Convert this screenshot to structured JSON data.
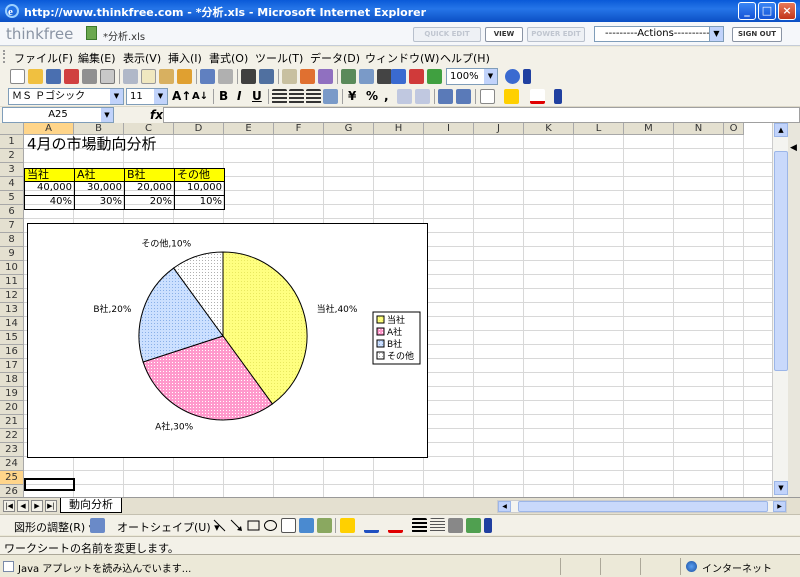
{
  "window": {
    "title": "http://www.thinkfree.com - *分析.xls - Microsoft Internet Explorer",
    "min_glyph": "_",
    "max_glyph": "□",
    "close_glyph": "×"
  },
  "header": {
    "logo": "thinkfree",
    "doc_name": "*分析.xls",
    "buttons": [
      "QUICK EDIT",
      "VIEW",
      "POWER EDIT"
    ],
    "actions_select": "---------Actions----------",
    "sign_out": "SIGN OUT"
  },
  "menu": [
    "ファイル(F)",
    "編集(E)",
    "表示(V)",
    "挿入(I)",
    "書式(O)",
    "ツール(T)",
    "データ(D)",
    "ウィンドウ(W)",
    "ヘルプ(H)"
  ],
  "toolbar": {
    "zoom": "100%"
  },
  "format": {
    "font": "ＭＳ Ｐゴシック",
    "size": "11",
    "grow": "A↑",
    "shrink": "A↓",
    "bold": "B",
    "italic": "I",
    "underline": "U",
    "currency": "¥",
    "percent": "%",
    "comma": ","
  },
  "formula": {
    "cell_ref": "A25",
    "fx": "fx"
  },
  "columns": [
    "A",
    "B",
    "C",
    "D",
    "E",
    "F",
    "G",
    "H",
    "I",
    "J",
    "K",
    "L",
    "M",
    "N",
    "O"
  ],
  "rows": [
    "1",
    "2",
    "3",
    "4",
    "5",
    "6",
    "7",
    "8",
    "9",
    "10",
    "11",
    "12",
    "13",
    "14",
    "15",
    "16",
    "17",
    "18",
    "19",
    "20",
    "21",
    "22",
    "23",
    "24",
    "25",
    "26"
  ],
  "cells": {
    "a1": "4月の市場動向分析",
    "headers": [
      "当社",
      "A社",
      "B社",
      "その他"
    ],
    "values": [
      "40,000",
      "30,000",
      "20,000",
      "10,000"
    ],
    "percents": [
      "40%",
      "30%",
      "20%",
      "10%"
    ]
  },
  "chart_data": {
    "type": "pie",
    "categories": [
      "当社",
      "A社",
      "B社",
      "その他"
    ],
    "values": [
      40,
      30,
      20,
      10
    ],
    "slice_labels": [
      "当社,40%",
      "A社,30%",
      "B社,20%",
      "その他,10%"
    ],
    "colors": [
      "#ffff80",
      "#ff99cc",
      "#cce0ff",
      "#ffffff"
    ],
    "legend_position": "right",
    "title": ""
  },
  "sheet": {
    "tab": "動向分析"
  },
  "drawing": {
    "draw_menu": "図形の調整(R) ▾",
    "autoshape_menu": "オートシェイプ(U) ▾"
  },
  "status": {
    "app_message": "ワークシートの名前を変更します。",
    "ie_message": "Java アプレットを読み込んでいます...",
    "zone": "インターネット"
  },
  "accents": {
    "selection": "#ffd58a",
    "header_fill": "#ffff00"
  }
}
